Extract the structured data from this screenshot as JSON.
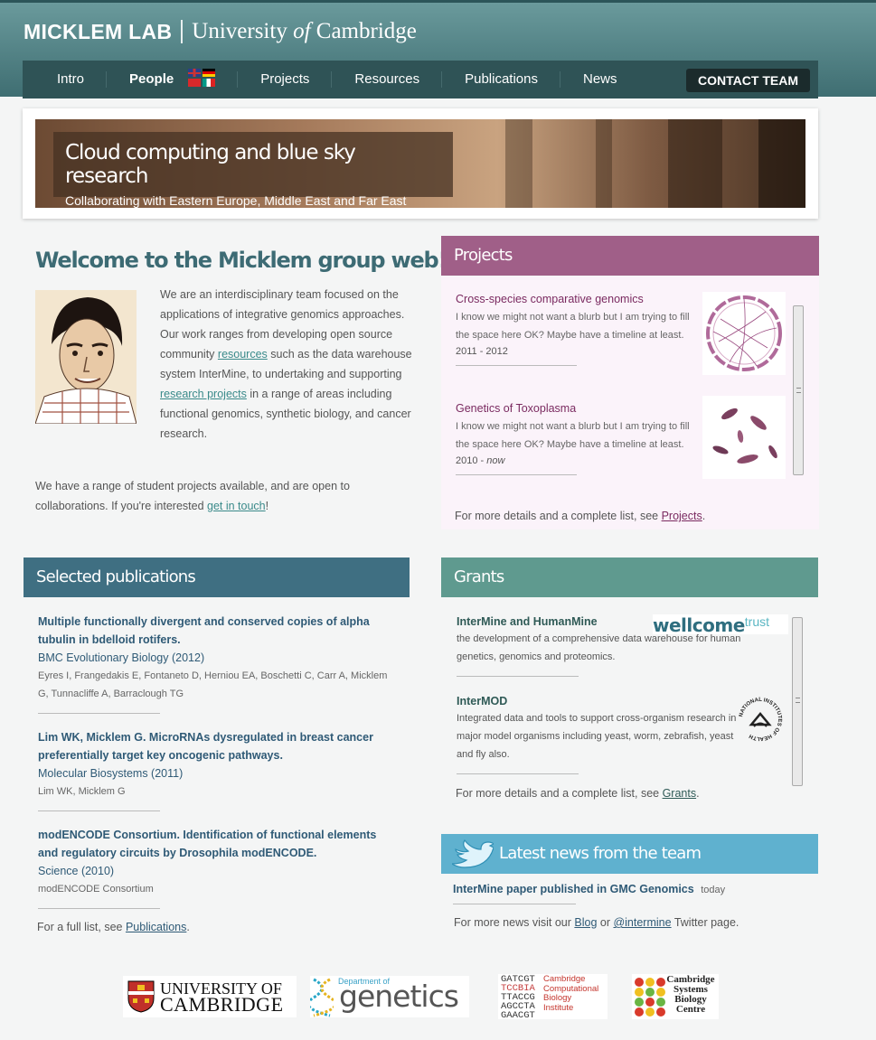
{
  "header": {
    "lab_name": "MICKLEM LAB",
    "university_prefix": "University",
    "university_of": "of",
    "university_suffix": "Cambridge"
  },
  "nav": {
    "items": [
      "Intro",
      "People",
      "Projects",
      "Resources",
      "Publications",
      "News"
    ],
    "active": "People",
    "contact_label": "CONTACT TEAM"
  },
  "banner": {
    "title": "Cloud computing and blue sky research",
    "subtitle": "Collaborating with Eastern Europe, Middle East and Far East"
  },
  "welcome": {
    "title": "Welcome to the Micklem group web!",
    "p1_a": "We are an interdisciplinary team focused on the applications of integrative genomics approaches. Our work ranges from developing open source community ",
    "p1_link1": "resources",
    "p1_b": " such as the data warehouse system InterMine, to undertaking and supporting ",
    "p1_link2": "research projects",
    "p1_c": " in a range of areas including functional genomics, synthetic biology, and cancer research.",
    "p2_a": "We have a range of student projects available, and are open to collaborations. If you're interested ",
    "p2_link": "get in touch",
    "p2_b": "!"
  },
  "projects": {
    "heading": "Projects",
    "items": [
      {
        "title": "Cross-species comparative genomics",
        "desc": "I know we might not want a blurb but I am trying to fill the space here OK? Maybe have a timeline at least.",
        "years": "2011 - 2012"
      },
      {
        "title": "Genetics of Toxoplasma",
        "desc": "I know we might not want a blurb but I am trying to fill the space here OK? Maybe have a timeline at least.",
        "years_start": "2010 - ",
        "years_end": "now"
      }
    ],
    "more_text": "For more details and a complete list, see ",
    "more_link": "Projects",
    "more_end": "."
  },
  "publications": {
    "heading": "Selected publications",
    "items": [
      {
        "title": "Multiple functionally divergent and conserved copies of alpha tubulin in bdelloid rotifers.",
        "journal": "BMC Evolutionary Biology (2012)",
        "authors": "Eyres I, Frangedakis E, Fontaneto D, Herniou EA, Boschetti C, Carr A, Micklem G, Tunnacliffe A, Barraclough TG"
      },
      {
        "title": "Lim WK, Micklem G. MicroRNAs dysregulated in breast cancer preferentially target key oncogenic pathways.",
        "journal": "Molecular Biosystems (2011)",
        "authors": "Lim WK, Micklem G"
      },
      {
        "title": "modENCODE Consortium. Identification of functional elements and regulatory circuits by Drosophila modENCODE.",
        "journal": "Science (2010)",
        "authors": "modENCODE Consortium"
      }
    ],
    "more_text": "For a full list, see ",
    "more_link": "Publications",
    "more_end": "."
  },
  "grants": {
    "heading": "Grants",
    "items": [
      {
        "title": "InterMine and HumanMine",
        "desc": "the development of a comprehensive data warehouse for human genetics, genomics and proteomics.",
        "logo_a": "wellcome",
        "logo_b": "trust"
      },
      {
        "title": "InterMOD",
        "desc": "Integrated data and tools to support cross-organism research in major model organisms including yeast, worm, zebrafish, yeast and fly also.",
        "logo": "NATIONAL INSTITUTES OF HEALTH"
      }
    ],
    "more_text": "For more details and a complete list, see ",
    "more_link": "Grants",
    "more_end": "."
  },
  "news": {
    "heading": "Latest news from the team",
    "item_title": "InterMine paper published in GMC Genomics",
    "item_time": "today",
    "more_a": "For more news visit our ",
    "more_link1": "Blog",
    "more_b": " or ",
    "more_link2": "@intermine",
    "more_c": " Twitter page."
  },
  "footer": {
    "cambridge_line1": "UNIVERSITY OF",
    "cambridge_line2": "CAMBRIDGE",
    "genetics_small": "Department of",
    "genetics_big": "genetics",
    "ccbi_codes": [
      "GATCGT",
      "TCCBIA",
      "TTACCG",
      "AGCCTA",
      "GAACGT"
    ],
    "ccbi_text": [
      "Cambridge",
      "Computational",
      "Biology",
      "Institute"
    ],
    "csbc_text": [
      "Cambridge",
      "Systems",
      "Biology",
      "Centre"
    ]
  },
  "colors": {
    "header": "#4f8084",
    "nav": "#2f5356",
    "projects": "#a05f88",
    "publications": "#3f6f82",
    "grants": "#5f9a8f",
    "news": "#5fb1cf"
  }
}
